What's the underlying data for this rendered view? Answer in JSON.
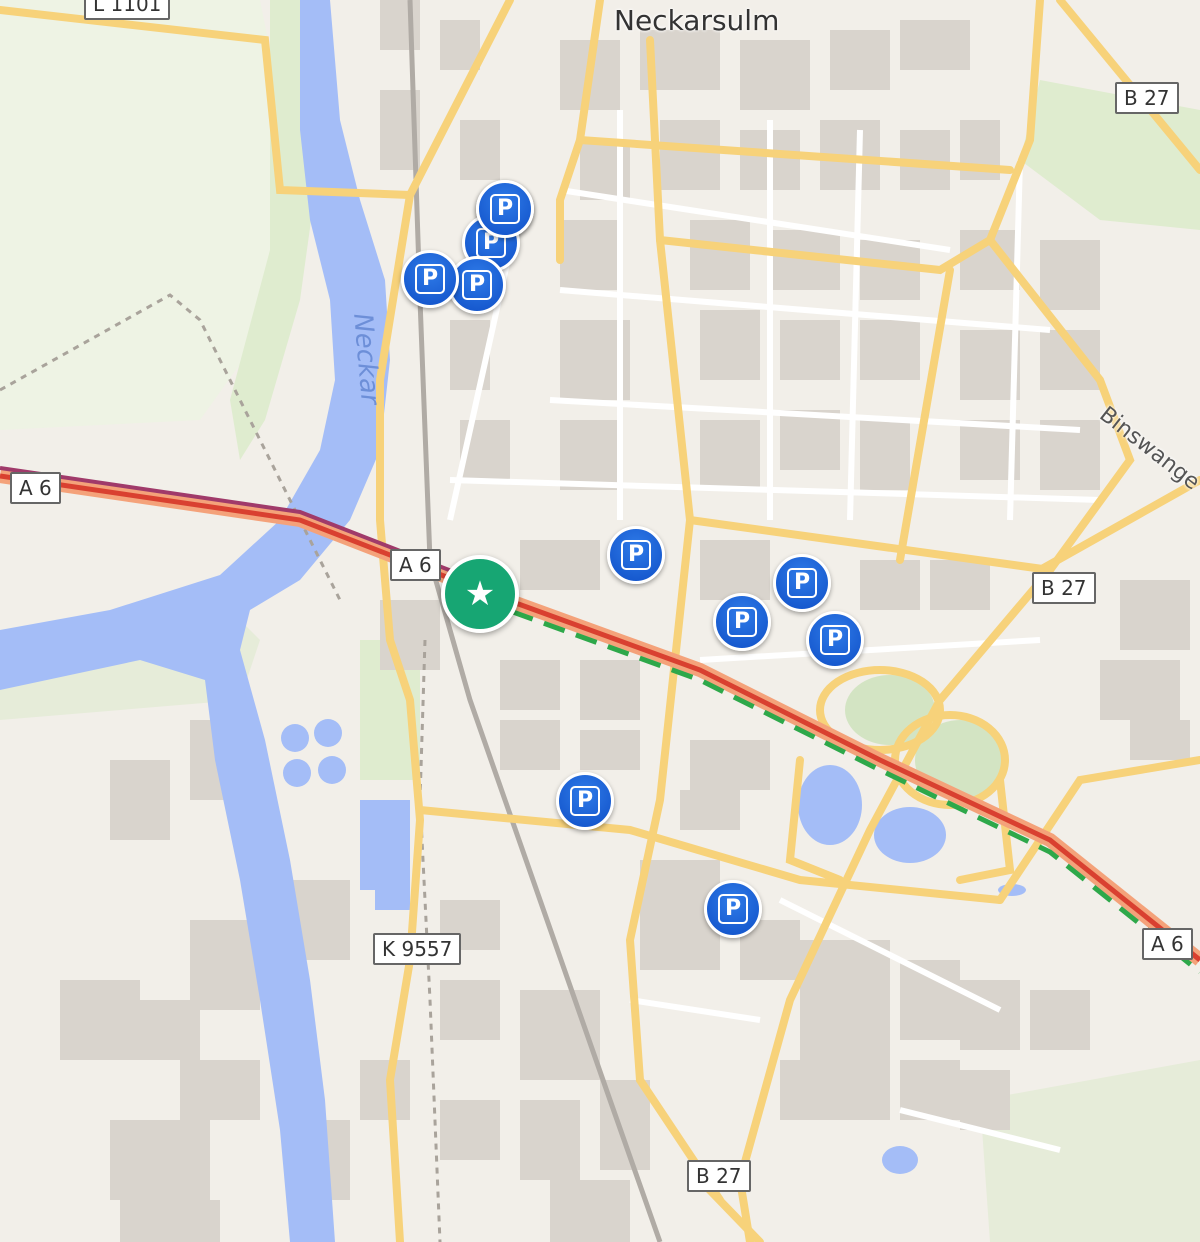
{
  "map": {
    "city_label": "Neckarsulm",
    "river_label": "Neckar",
    "street_label": "Binswange",
    "road_shields": {
      "l1101": "L 1101",
      "b27_top": "B 27",
      "b27_mid": "B 27",
      "b27_bottom": "B 27",
      "a6_left": "A 6",
      "a6_center": "A 6",
      "a6_right": "A 6",
      "k9557": "K 9557"
    },
    "parking_symbol": "P",
    "poi_icon": "★",
    "icons": {
      "parking": "parking-icon",
      "poi": "star-icon"
    },
    "colors": {
      "background": "#f2efe9",
      "water": "#a4bdf7",
      "major_road": "#f7d27a",
      "motorway_traffic": "#e24b2f",
      "eco_route": "#2ea84a",
      "parking": "#1a5fd6",
      "poi": "#17a673"
    }
  }
}
